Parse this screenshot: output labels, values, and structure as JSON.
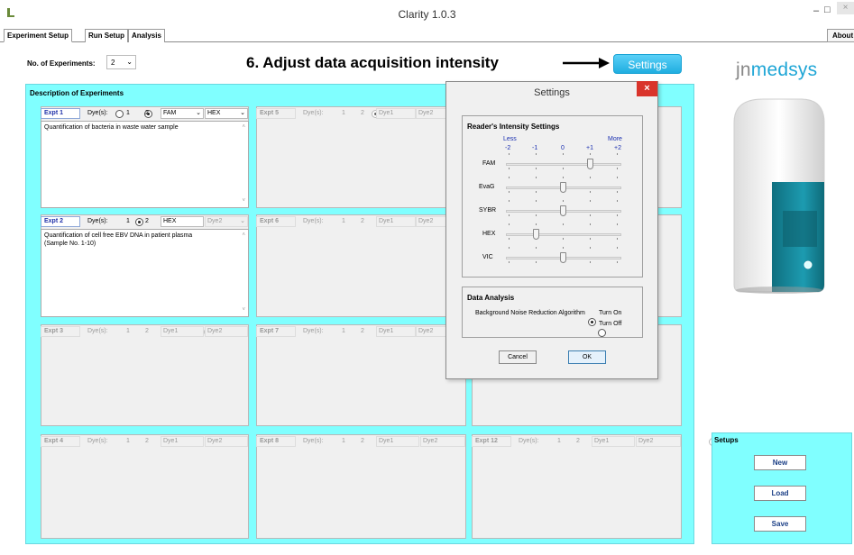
{
  "window": {
    "title": "Clarity 1.0.3",
    "min_glyph": "‒",
    "max_glyph": "□",
    "close_glyph": "×"
  },
  "tabs": [
    {
      "label": "Experiment Setup"
    },
    {
      "label": "Run Setup"
    },
    {
      "label": "Analysis"
    },
    {
      "label": "About"
    }
  ],
  "top": {
    "num_label": "No. of Experiments:",
    "num_value": "2",
    "annotation": "6. Adjust data acquisition intensity",
    "settings_button": "Settings",
    "brand_prefix": "jn",
    "brand_suffix": "medsys"
  },
  "description": {
    "title": "Description of Experiments"
  },
  "common": {
    "dyes_label": "Dye(s):",
    "opt1": "1",
    "opt2": "2"
  },
  "experiments": [
    {
      "name": "Expt 1",
      "dye1": "FAM",
      "dye2": "HEX",
      "text": "Quantification of bacteria in waste water sample",
      "text2": ""
    },
    {
      "name": "Expt 2",
      "dye1": "HEX",
      "dye2": "Dye2",
      "text": "Quantification of cell free EBV DNA in patient plasma",
      "text2": "(Sample No. 1-10)"
    },
    {
      "name": "Expt 3",
      "dye1": "Dye1",
      "dye2": "Dye2"
    },
    {
      "name": "Expt 4",
      "dye1": "Dye1",
      "dye2": "Dye2"
    },
    {
      "name": "Expt 5",
      "dye1": "Dye1",
      "dye2": "Dye2"
    },
    {
      "name": "Expt 6",
      "dye1": "Dye1",
      "dye2": "Dye2"
    },
    {
      "name": "Expt 7",
      "dye1": "Dye1",
      "dye2": "Dye2"
    },
    {
      "name": "Expt 8",
      "dye1": "Dye1",
      "dye2": "Dye2"
    },
    {
      "name": "Expt 12",
      "dye1": "Dye1",
      "dye2": "Dye2"
    }
  ],
  "setups": {
    "title": "Setups",
    "new": "New",
    "load": "Load",
    "save": "Save"
  },
  "dialog": {
    "title": "Settings",
    "intensity_title": "Reader's Intensity Settings",
    "less": "Less",
    "more": "More",
    "scale": [
      "-2",
      "-1",
      "0",
      "+1",
      "+2"
    ],
    "sliders": [
      {
        "label": "FAM",
        "level": 1
      },
      {
        "label": "EvaG",
        "level": 0
      },
      {
        "label": "SYBR",
        "level": 0
      },
      {
        "label": "HEX",
        "level": -1
      },
      {
        "label": "VIC",
        "level": 0
      }
    ],
    "analysis_title": "Data Analysis",
    "bg_label": "Background Noise Reduction Algorithm",
    "turn_on": "Turn On",
    "turn_off": "Turn Off",
    "cancel": "Cancel",
    "ok": "OK"
  },
  "colors": {
    "panel": "#80ffff",
    "accent": "#1fa6d6",
    "close": "#d9342b"
  }
}
